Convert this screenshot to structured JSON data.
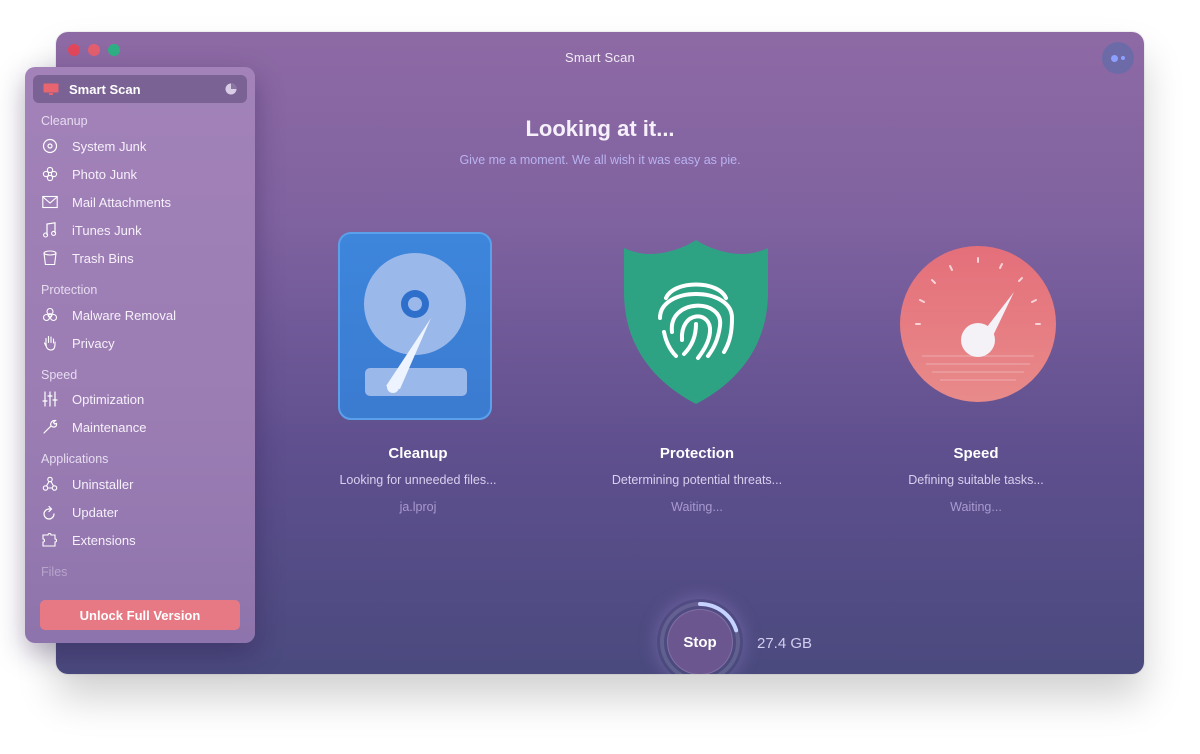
{
  "window": {
    "title": "Smart Scan"
  },
  "header": {
    "title": "Looking at it...",
    "subtitle": "Give me a moment. We all wish it was easy as pie."
  },
  "modules": [
    {
      "title": "Cleanup",
      "status": "Looking for unneeded files...",
      "detail": "ja.lproj",
      "icon": "hard-drive-icon"
    },
    {
      "title": "Protection",
      "status": "Determining potential threats...",
      "detail": "Waiting...",
      "icon": "shield-fingerprint-icon"
    },
    {
      "title": "Speed",
      "status": "Defining suitable tasks...",
      "detail": "Waiting...",
      "icon": "speedometer-icon"
    }
  ],
  "scan_control": {
    "stop_label": "Stop",
    "size_scanned": "27.4 GB",
    "progress": 0.2
  },
  "sidebar": {
    "active": {
      "label": "Smart Scan",
      "icon": "monitor-icon"
    },
    "sections": [
      {
        "heading": "Cleanup",
        "items": [
          {
            "label": "System Junk",
            "icon": "disk-icon"
          },
          {
            "label": "Photo Junk",
            "icon": "flower-icon"
          },
          {
            "label": "Mail Attachments",
            "icon": "envelope-icon"
          },
          {
            "label": "iTunes Junk",
            "icon": "music-note-icon"
          },
          {
            "label": "Trash Bins",
            "icon": "trash-icon"
          }
        ]
      },
      {
        "heading": "Protection",
        "items": [
          {
            "label": "Malware Removal",
            "icon": "biohazard-icon"
          },
          {
            "label": "Privacy",
            "icon": "hand-icon"
          }
        ]
      },
      {
        "heading": "Speed",
        "items": [
          {
            "label": "Optimization",
            "icon": "sliders-icon"
          },
          {
            "label": "Maintenance",
            "icon": "wrench-icon"
          }
        ]
      },
      {
        "heading": "Applications",
        "items": [
          {
            "label": "Uninstaller",
            "icon": "uninstaller-icon"
          },
          {
            "label": "Updater",
            "icon": "update-arrow-icon"
          },
          {
            "label": "Extensions",
            "icon": "puzzle-icon"
          }
        ]
      },
      {
        "heading": "Files",
        "items": []
      }
    ],
    "unlock_label": "Unlock Full Version"
  },
  "colors": {
    "window_gradient_top": "#8e6aa4",
    "window_gradient_bottom": "#4a4a7e",
    "sidebar": "#9b7db3",
    "unlock_button": "#e77985",
    "cleanup_icon": "#3b7fd6",
    "protection_icon": "#2ea384",
    "speed_icon": "#e47683"
  }
}
